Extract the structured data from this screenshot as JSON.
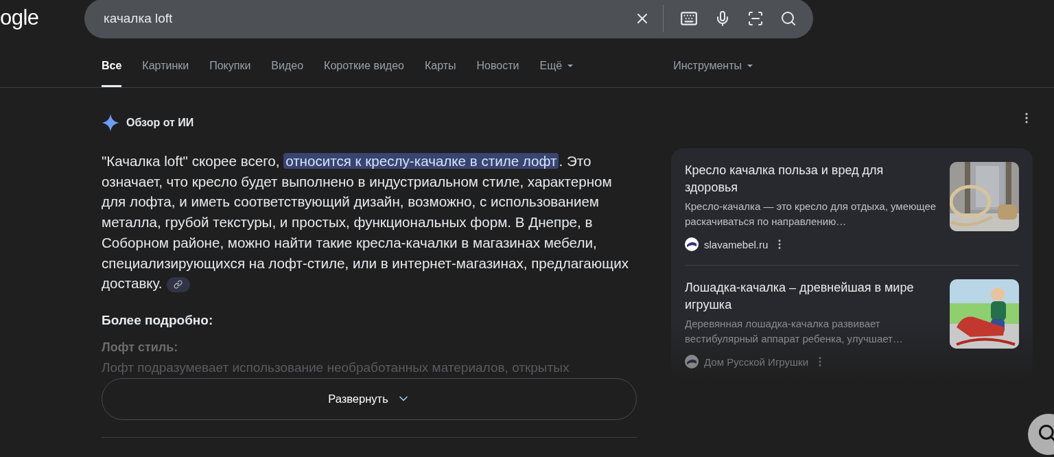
{
  "logo": "ogle",
  "search": {
    "value": "качалка loft"
  },
  "tabs": [
    {
      "label": "Все",
      "selected": true,
      "kind": "plain"
    },
    {
      "label": "Картинки",
      "selected": false,
      "kind": "plain"
    },
    {
      "label": "Покупки",
      "selected": false,
      "kind": "plain"
    },
    {
      "label": "Видео",
      "selected": false,
      "kind": "plain"
    },
    {
      "label": "Короткие видео",
      "selected": false,
      "kind": "plain"
    },
    {
      "label": "Карты",
      "selected": false,
      "kind": "plain"
    },
    {
      "label": "Новости",
      "selected": false,
      "kind": "plain"
    },
    {
      "label": "Ещё",
      "selected": false,
      "kind": "menu"
    }
  ],
  "tools": "Инструменты",
  "overview": {
    "title": "Обзор от ИИ",
    "summary": {
      "before": "\"Качалка loft\" скорее всего, ",
      "highlight": "относится к креслу-качалке в стиле лофт",
      "after": ". Это означает, что кресло будет выполнено в индустриальном стиле, характерном для лофта, и иметь соответствующий дизайн, возможно, с использованием металла, грубой текстуры, и простых, функциональных форм. В Днепре, в Соборном районе, можно найти такие кресла-качалки в магазинах мебели, специализирующихся на лофт-стиле, или в интернет-магазинах, предлагающих доставку."
    },
    "more_heading": "Более подробно:",
    "sub_heading": "Лофт стиль:",
    "sub_text": "Лофт подразумевает использование необработанных материалов, открытых",
    "expand": "Развернуть"
  },
  "sources": [
    {
      "title": "Кресло качалка польза и вред для здоровья",
      "snippet": "Кресло-качалка — это кресло для отдыха, умеющее раскачиваться по направлению…",
      "site": "slavamebel.ru",
      "faded": false,
      "kind": "chair"
    },
    {
      "title": "Лошадка-качалка – древнейшая в мире игрушка",
      "snippet": "Деревянная лошадка-качалка развивает вестибулярный аппарат ребенка, улучшает…",
      "site": "Дом Русской Игрушки",
      "faded": true,
      "kind": "horse"
    }
  ]
}
